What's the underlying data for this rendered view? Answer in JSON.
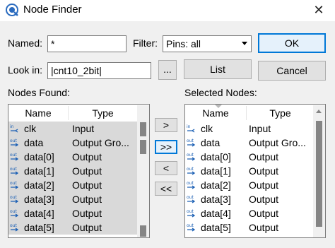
{
  "window": {
    "title": "Node Finder",
    "close_symbol": "✕"
  },
  "named": {
    "label": "Named:",
    "value": "*"
  },
  "filter": {
    "label": "Filter:",
    "selected": "Pins: all"
  },
  "lookin": {
    "label": "Look in:",
    "value": "|cnt10_2bit|"
  },
  "buttons": {
    "ok": "OK",
    "browse": "...",
    "list": "List",
    "cancel": "Cancel",
    "add_one": ">",
    "add_all": ">>",
    "remove_one": "<",
    "remove_all": "<<"
  },
  "nodes_found": {
    "label": "Nodes Found:",
    "columns": [
      "Name",
      "Type"
    ],
    "rows": [
      {
        "icon": "in",
        "name": "clk",
        "type": "Input"
      },
      {
        "icon": "out",
        "name": "data",
        "type": "Output Gro..."
      },
      {
        "icon": "out",
        "name": "data[0]",
        "type": "Output"
      },
      {
        "icon": "out",
        "name": "data[1]",
        "type": "Output"
      },
      {
        "icon": "out",
        "name": "data[2]",
        "type": "Output"
      },
      {
        "icon": "out",
        "name": "data[3]",
        "type": "Output"
      },
      {
        "icon": "out",
        "name": "data[4]",
        "type": "Output"
      },
      {
        "icon": "out",
        "name": "data[5]",
        "type": "Output"
      }
    ]
  },
  "selected_nodes": {
    "label": "Selected Nodes:",
    "columns": [
      "Name",
      "Type"
    ],
    "rows": [
      {
        "icon": "in",
        "name": "clk",
        "type": "Input"
      },
      {
        "icon": "out",
        "name": "data",
        "type": "Output Gro..."
      },
      {
        "icon": "out",
        "name": "data[0]",
        "type": "Output"
      },
      {
        "icon": "out",
        "name": "data[1]",
        "type": "Output"
      },
      {
        "icon": "out",
        "name": "data[2]",
        "type": "Output"
      },
      {
        "icon": "out",
        "name": "data[3]",
        "type": "Output"
      },
      {
        "icon": "out",
        "name": "data[4]",
        "type": "Output"
      },
      {
        "icon": "out",
        "name": "data[5]",
        "type": "Output"
      }
    ]
  },
  "colors": {
    "pin_in": "#1a5fb4",
    "pin_out": "#1a5fb4",
    "accent": "#0078d7"
  }
}
